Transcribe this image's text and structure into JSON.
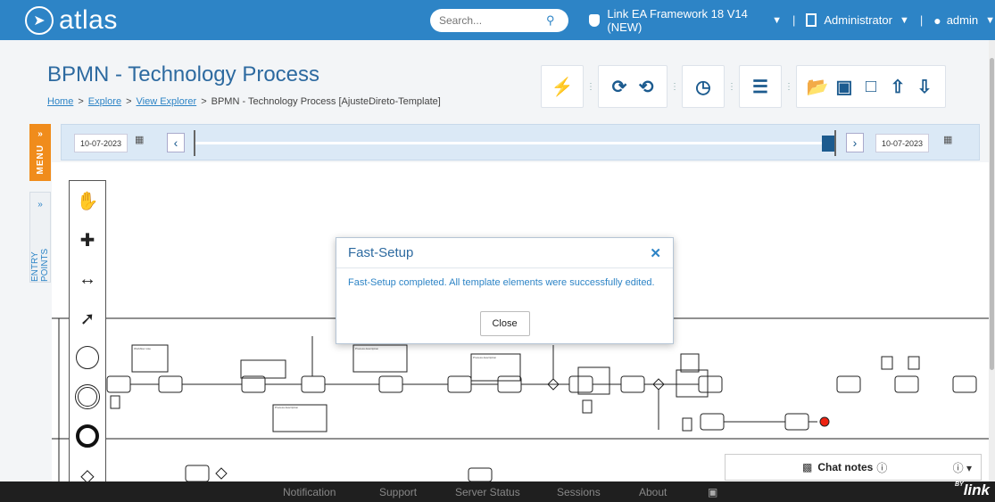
{
  "topbar": {
    "logo_text": "atlas",
    "search_placeholder": "Search...",
    "framework": "Link EA Framework 18 V14 (NEW)",
    "role": "Administrator",
    "user": "admin"
  },
  "header": {
    "title": "BPMN - Technology Process",
    "breadcrumb": [
      "Home",
      "Explore",
      "View Explorer",
      "BPMN - Technology Process [AjusteDireto-Template]"
    ]
  },
  "timeline": {
    "start_date": "10-07-2023",
    "end_date": "10-07-2023"
  },
  "sidebar": {
    "menu_label": "MENU",
    "entry_points_label": "ENTRY POINTS"
  },
  "modal": {
    "title": "Fast-Setup",
    "message": "Fast-Setup completed. All template elements were successfully edited.",
    "close_label": "Close"
  },
  "chat": {
    "title": "Chat notes"
  },
  "footer": {
    "items": [
      "Notification",
      "Support",
      "Server Status",
      "Sessions",
      "About"
    ],
    "brand": "link",
    "brand_prefix": "BY"
  },
  "colors": {
    "topbar": "#2d84c6",
    "accent_orange": "#f08c1c",
    "title_blue": "#2d6aa0",
    "footer": "#1f1f1f"
  }
}
